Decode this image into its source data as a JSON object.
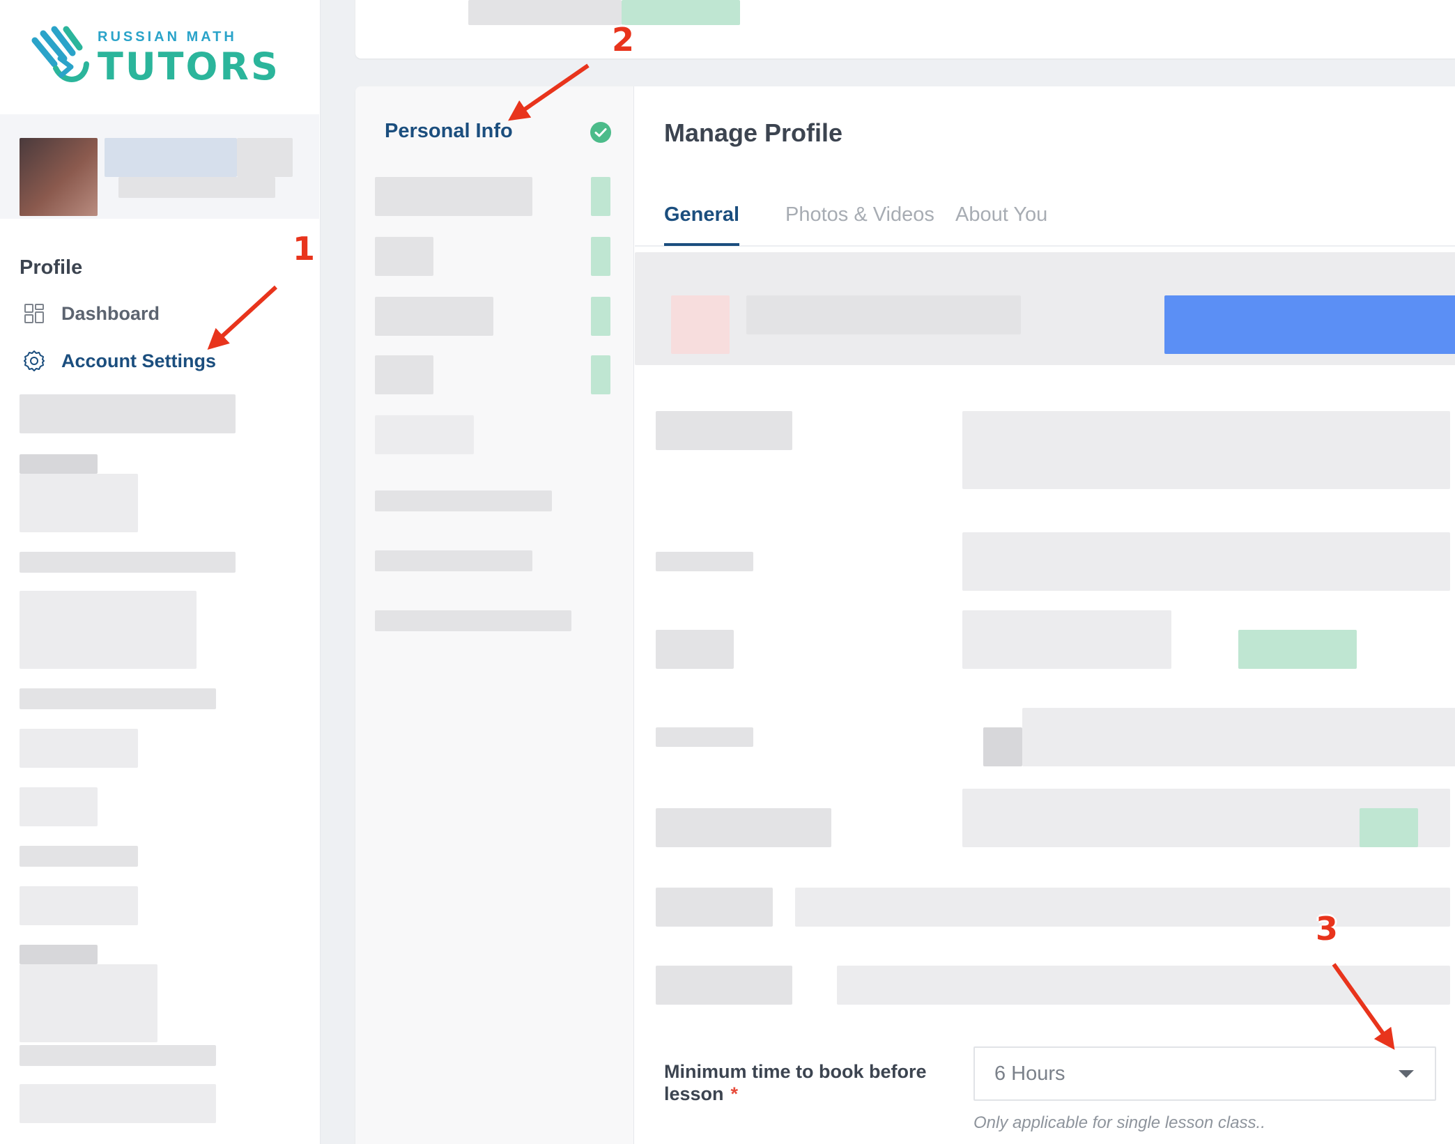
{
  "brand": {
    "top_text": "RUSSIAN MATH",
    "main_text": "TUTORS",
    "colors": {
      "blue": "#2aa3c9",
      "teal": "#2bb59b"
    },
    "icon": "logo-hand-mark-icon"
  },
  "sidebar": {
    "section_title": "Profile",
    "items": [
      {
        "label": "Dashboard",
        "icon": "grid-icon",
        "active": false
      },
      {
        "label": "Account Settings",
        "icon": "gear-icon",
        "active": true
      }
    ]
  },
  "steps": {
    "active_label": "Personal Info",
    "active_status_icon": "check-circle-icon",
    "status_color": "#4cbb8a"
  },
  "main": {
    "title": "Manage Profile",
    "tabs": [
      {
        "label": "General",
        "active": true
      },
      {
        "label": "Photos & Videos",
        "active": false
      },
      {
        "label": "About You",
        "active": false
      }
    ],
    "booking_field": {
      "label": "Minimum time to book before lesson",
      "required_mark": "*",
      "value": "6 Hours",
      "help_text": "Only applicable for single lesson class.."
    }
  },
  "annotations": {
    "first": "1",
    "second": "2",
    "third": "3",
    "color": "#e8341c"
  },
  "theme": {
    "active_text": "#1b4e7e",
    "muted_text": "#a7acb3"
  }
}
